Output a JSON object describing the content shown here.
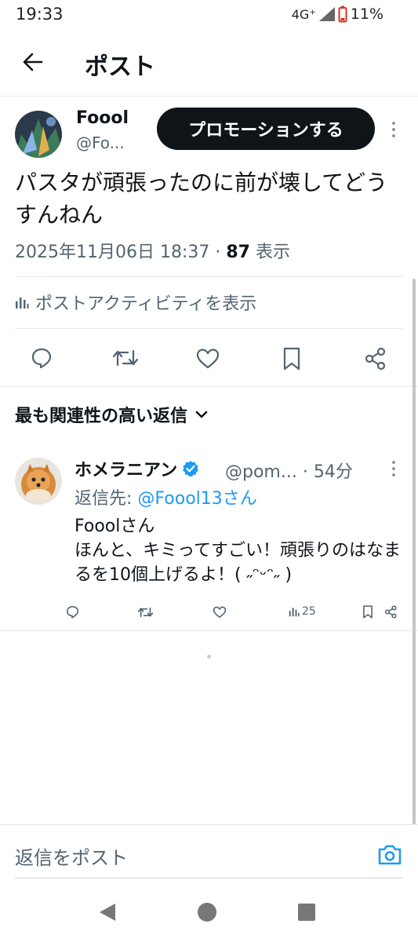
{
  "status_bar": {
    "time": "19:33",
    "network": "4G⁺",
    "battery": "11%"
  },
  "header": {
    "title": "ポスト"
  },
  "post": {
    "author_name": "Foool",
    "author_handle": "@Fo...",
    "promote_label": "プロモーションする",
    "text": "パスタが頑張ったのに前が壊してどうすんねん",
    "timestamp": "2025年11月06日 18:37",
    "separator": "·",
    "views": "87",
    "views_label": "表示",
    "activity_label": "ポストアクティビティを表示"
  },
  "replies_sort": {
    "label": "最も関連性の高い返信"
  },
  "reply": {
    "name": "ホメラニアン",
    "handle": "@pom...",
    "time": "· 54分",
    "reply_to_prefix": "返信先: ",
    "reply_to_handle": "@Foool13さん",
    "line1": "Fooolさん",
    "line2": "ほんと、キミってすごい！頑張りのはなまるを10個上げるよ！( ˶ᵔᵕᵔ˶ )",
    "views": "25"
  },
  "composer": {
    "placeholder": "返信をポスト"
  },
  "icons": {
    "back": "arrow-left-icon",
    "more": "more-vertical-icon",
    "reply": "reply-icon",
    "repost": "repost-icon",
    "like": "heart-icon",
    "bookmark": "bookmark-icon",
    "share": "share-icon",
    "analytics": "bar-chart-icon",
    "verified": "verified-badge-icon",
    "camera": "camera-icon",
    "chevron": "chevron-down-icon"
  },
  "colors": {
    "accent": "#1d9bf0",
    "text": "#0f1419",
    "secondary": "#536471"
  }
}
